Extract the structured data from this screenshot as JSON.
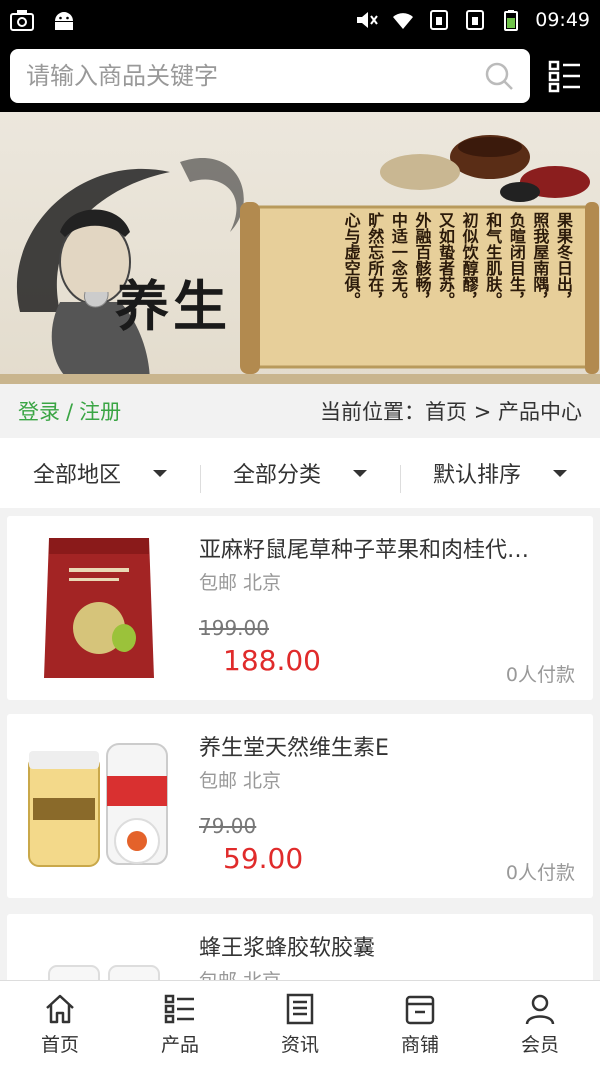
{
  "status_bar": {
    "time": "09:49",
    "left_icons": [
      "screenshot-icon",
      "android-icon"
    ],
    "right_icons": [
      "mute-icon",
      "wifi-icon",
      "sim1-icon",
      "sim2-icon",
      "battery-icon"
    ]
  },
  "search": {
    "placeholder": "请输入商品关键字",
    "icon": "search-icon",
    "menu_icon": "menu-grid-icon"
  },
  "banner": {
    "title": "养生",
    "poem": [
      "果果冬日出，",
      "照我屋南隅，",
      "负暄闭目生，",
      "和气生肌肤。",
      "初似饮醇醪，",
      "又如蛰者苏。",
      "外融百骸畅，",
      "中适一念无。",
      "旷然忘所在，",
      "心与虚空俱。"
    ]
  },
  "nav": {
    "login": "登录",
    "sep": "/",
    "register": "注册",
    "breadcrumb": "当前位置：首页 > 产品中心"
  },
  "filters": [
    {
      "label": "全部地区"
    },
    {
      "label": "全部分类"
    },
    {
      "label": "默认排序"
    }
  ],
  "products": [
    {
      "title": "亚麻籽鼠尾草种子苹果和肉桂代…",
      "meta": "包邮 北京",
      "old_price": "199.00",
      "price": "188.00",
      "paid": "0人付款"
    },
    {
      "title": "养生堂天然维生素E",
      "meta": "包邮 北京",
      "old_price": "79.00",
      "price": "59.00",
      "paid": "0人付款"
    },
    {
      "title": "蜂王浆蜂胶软胶囊",
      "meta": "包邮 北京",
      "old_price": "",
      "price": "",
      "paid": ""
    }
  ],
  "tabs": [
    {
      "label": "首页",
      "icon": "home-icon"
    },
    {
      "label": "产品",
      "icon": "list-icon"
    },
    {
      "label": "资讯",
      "icon": "news-icon"
    },
    {
      "label": "商铺",
      "icon": "shop-icon"
    },
    {
      "label": "会员",
      "icon": "user-icon"
    }
  ],
  "colors": {
    "accent_green": "#3aa544",
    "price_red": "#e02b2b"
  }
}
